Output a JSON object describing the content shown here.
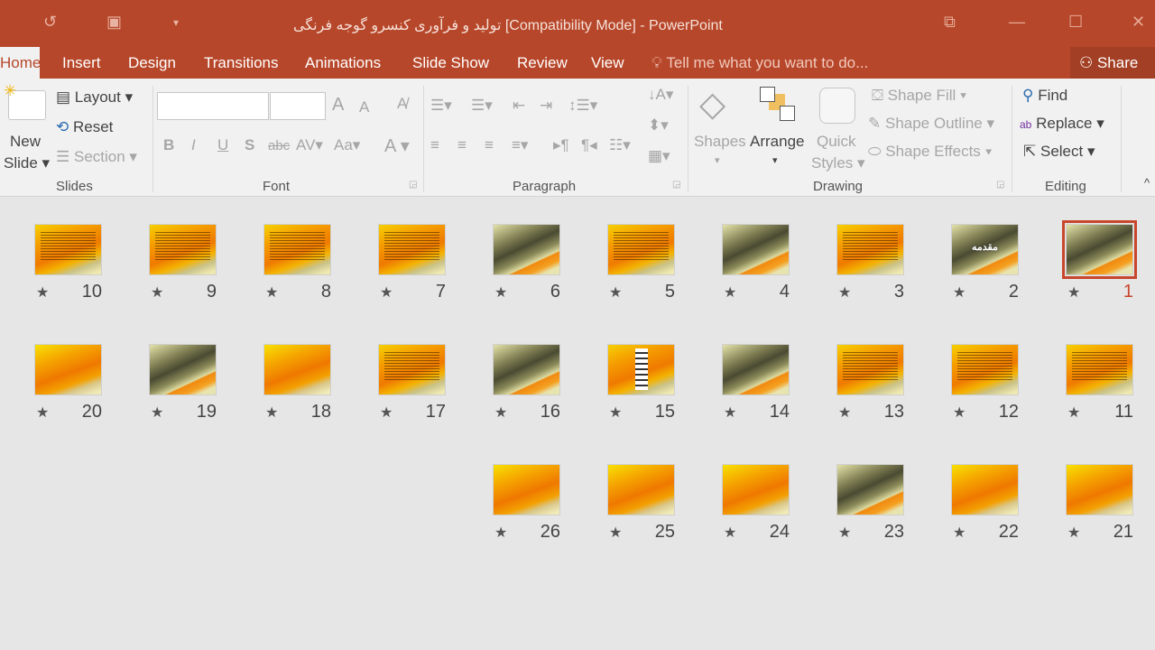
{
  "titlebar": {
    "title": "تولید و فرآوری کنسرو گوجه فرنگی  [Compatibility Mode] - PowerPoint",
    "undo_icon": "undo-icon",
    "present_icon": "start-from-beginning-icon",
    "customize_icon": "customize-qat-icon"
  },
  "tabs": [
    "Home",
    "Insert",
    "Design",
    "Transitions",
    "Animations",
    "Slide Show",
    "Review",
    "View"
  ],
  "tell_me": "Tell me what you want to do...",
  "share": "Share",
  "ribbon": {
    "slides": {
      "new_slide_1": "New",
      "new_slide_2": "Slide",
      "layout": "Layout",
      "reset": "Reset",
      "section": "Section",
      "group": "Slides"
    },
    "font": {
      "group": "Font",
      "font_name": "",
      "font_size": ""
    },
    "paragraph": {
      "group": "Paragraph"
    },
    "drawing": {
      "shapes": "Shapes",
      "arrange": "Arrange",
      "quick_1": "Quick",
      "quick_2": "Styles",
      "fill": "Shape Fill",
      "outline": "Shape Outline",
      "effects": "Shape Effects",
      "group": "Drawing"
    },
    "editing": {
      "find": "Find",
      "replace": "Replace",
      "select": "Select",
      "group": "Editing"
    }
  },
  "colors": {
    "accent": "#b7472a",
    "selection": "#c8462c"
  },
  "slides": [
    {
      "n": "1",
      "style": "dark",
      "selected": true
    },
    {
      "n": "2",
      "style": "dark",
      "title": "مقدمه"
    },
    {
      "n": "3",
      "style": "orange-text"
    },
    {
      "n": "4",
      "style": "dark"
    },
    {
      "n": "5",
      "style": "orange-text"
    },
    {
      "n": "6",
      "style": "dark"
    },
    {
      "n": "7",
      "style": "orange-text"
    },
    {
      "n": "8",
      "style": "orange-text"
    },
    {
      "n": "9",
      "style": "orange-text"
    },
    {
      "n": "10",
      "style": "orange-text"
    },
    {
      "n": "11",
      "style": "orange-text"
    },
    {
      "n": "12",
      "style": "orange-text"
    },
    {
      "n": "13",
      "style": "orange-text"
    },
    {
      "n": "14",
      "style": "dark"
    },
    {
      "n": "15",
      "style": "diagram"
    },
    {
      "n": "16",
      "style": "dark"
    },
    {
      "n": "17",
      "style": "orange-text"
    },
    {
      "n": "18",
      "style": "orange-plain"
    },
    {
      "n": "19",
      "style": "dark"
    },
    {
      "n": "20",
      "style": "orange-plain"
    },
    {
      "n": "21",
      "style": "orange-plain"
    },
    {
      "n": "22",
      "style": "orange-plain"
    },
    {
      "n": "23",
      "style": "dark"
    },
    {
      "n": "24",
      "style": "orange-plain"
    },
    {
      "n": "25",
      "style": "orange-plain"
    },
    {
      "n": "26",
      "style": "orange-plain"
    }
  ]
}
